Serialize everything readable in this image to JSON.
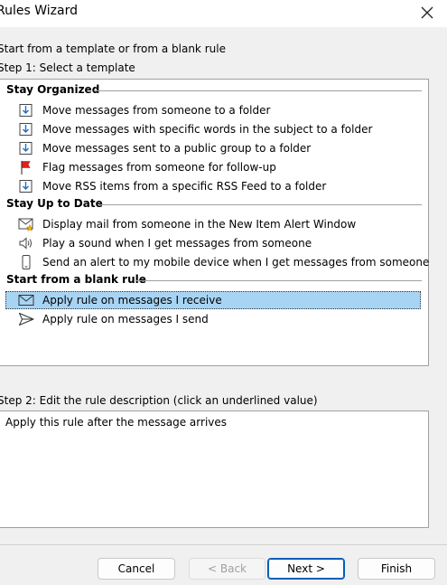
{
  "window": {
    "title": "Rules Wizard",
    "close_icon": "close-icon"
  },
  "intro_text": "Start from a template or from a blank rule",
  "step1_label": "Step 1: Select a template",
  "groups": [
    {
      "header": "Stay Organized"
    },
    {
      "header": "Stay Up to Date"
    },
    {
      "header": "Start from a blank rule"
    }
  ],
  "templates": [
    {
      "label": "Move messages from someone to a folder",
      "icon": "folder-move-icon"
    },
    {
      "label": "Move messages with specific words in the subject to a folder",
      "icon": "folder-move-icon"
    },
    {
      "label": "Move messages sent to a public group to a folder",
      "icon": "folder-move-icon"
    },
    {
      "label": "Flag messages from someone for follow-up",
      "icon": "red-flag-icon"
    },
    {
      "label": "Move RSS items from a specific RSS Feed to a folder",
      "icon": "folder-move-icon"
    },
    {
      "label": "Display mail from someone in the New Item Alert Window",
      "icon": "envelope-star-icon"
    },
    {
      "label": "Play a sound when I get messages from someone",
      "icon": "speaker-icon"
    },
    {
      "label": "Send an alert to my mobile device when I get messages from someone",
      "icon": "mobile-phone-icon"
    },
    {
      "label": "Apply rule on messages I receive",
      "icon": "envelope-icon",
      "selected": true
    },
    {
      "label": "Apply rule on messages I send",
      "icon": "send-icon"
    }
  ],
  "step2_label": "Step 2: Edit the rule description (click an underlined value)",
  "rule_description": "Apply this rule after the message arrives",
  "buttons": {
    "cancel": "Cancel",
    "back": "< Back",
    "next": "Next >",
    "finish": "Finish"
  },
  "colors": {
    "selection": "#a8d4f4",
    "flag": "#e02020",
    "icon_blue": "#1f6fc4",
    "primary_border": "#005fb8"
  }
}
